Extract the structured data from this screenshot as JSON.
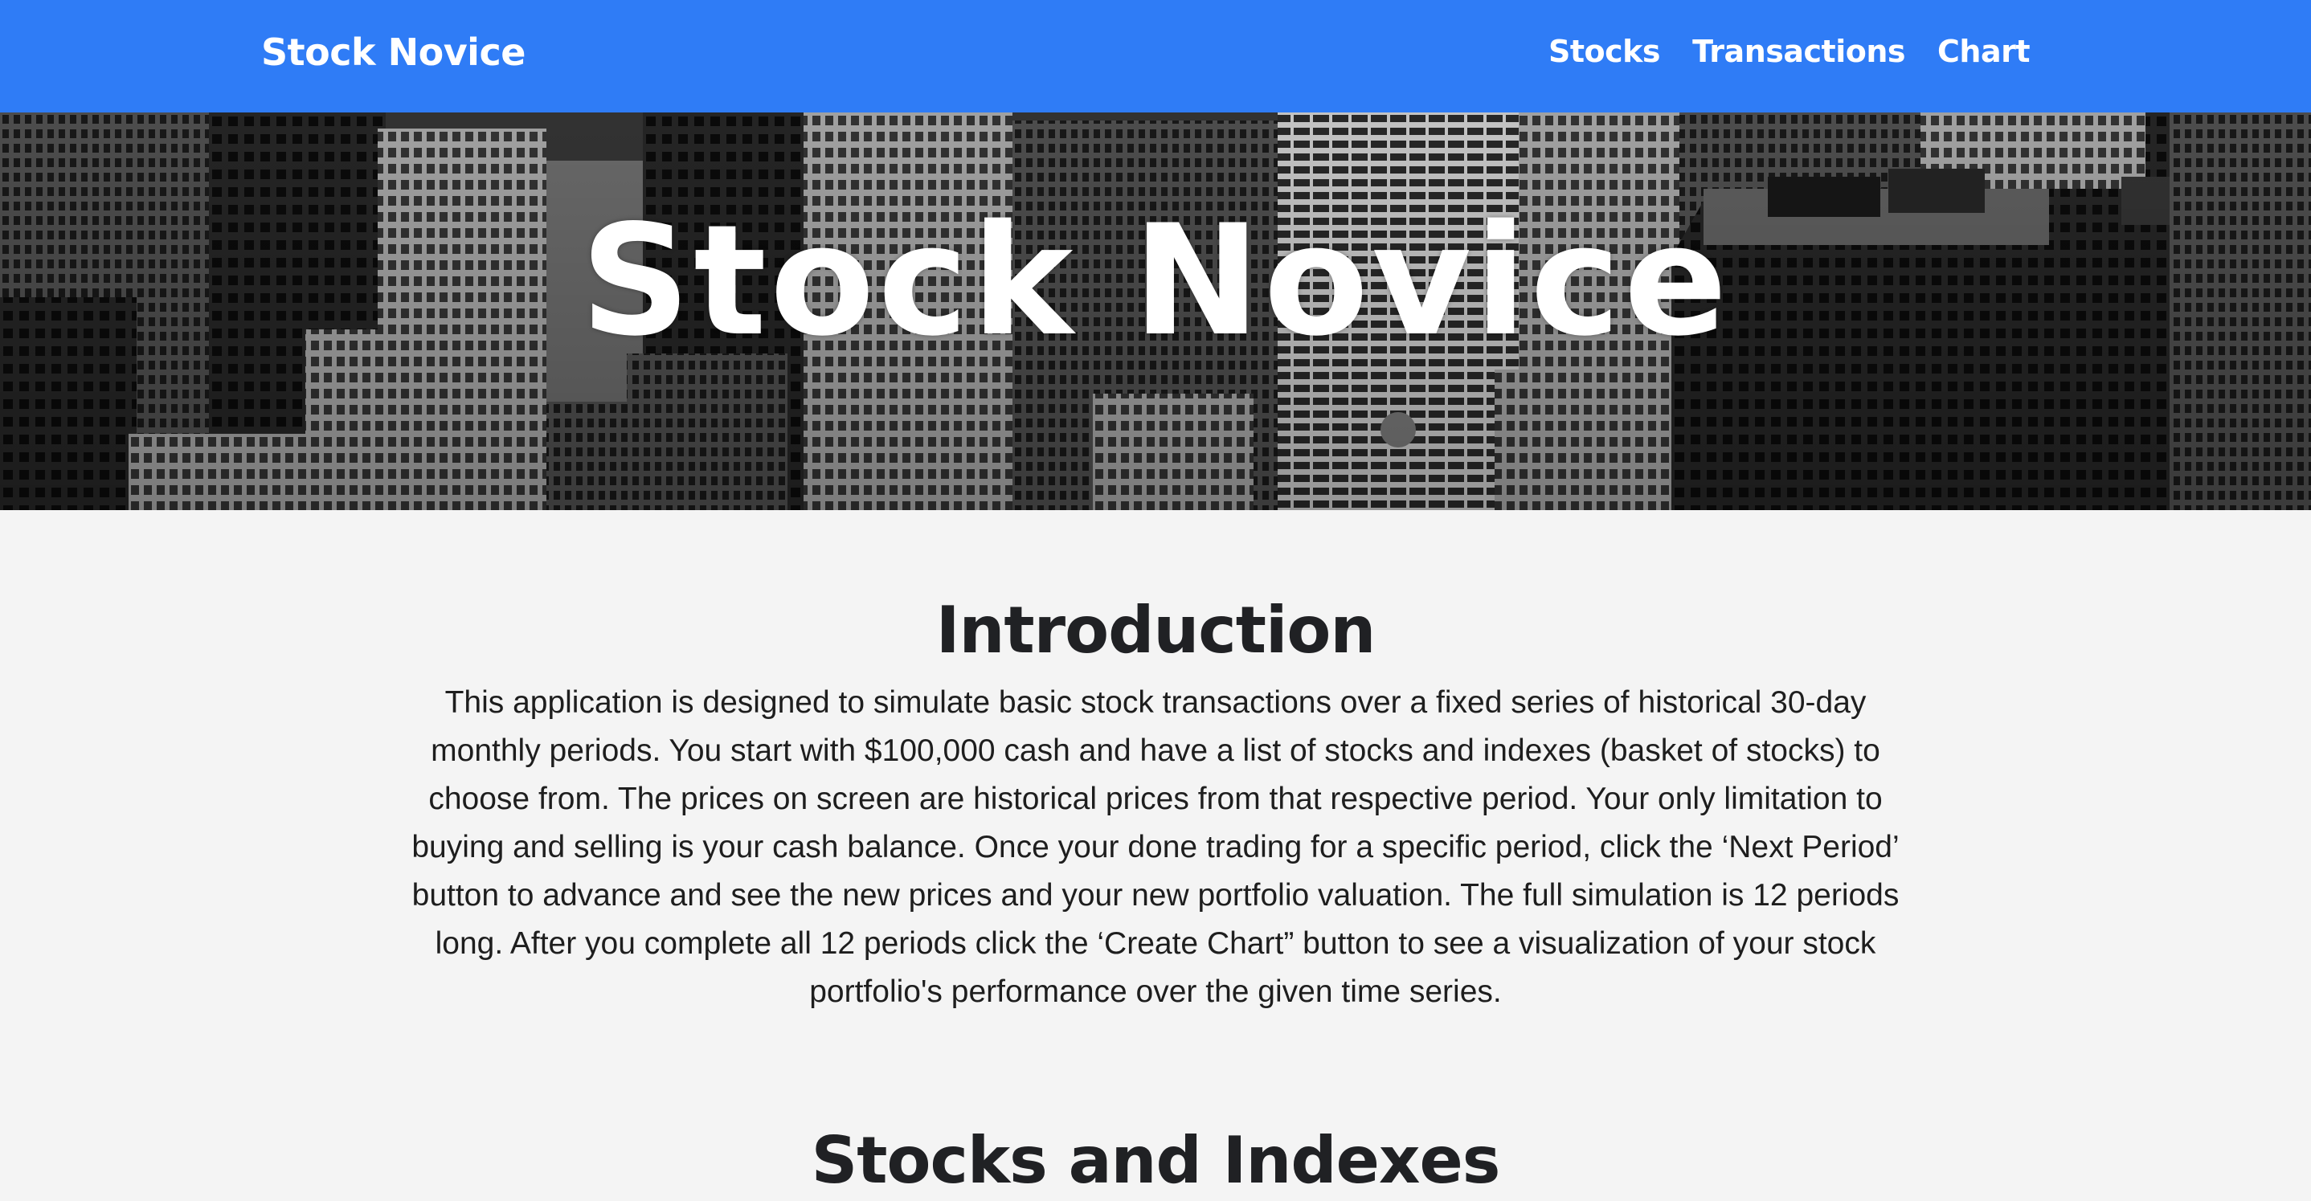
{
  "navbar": {
    "brand": "Stock Novice",
    "links": [
      "Stocks",
      "Transactions",
      "Chart"
    ],
    "background_color": "#2f7cf6"
  },
  "hero": {
    "title": "Stock Novice",
    "background": "black-and-white aerial photo of city skyscrapers"
  },
  "intro": {
    "title": "Introduction",
    "text": "This application is designed to simulate basic stock transactions over a fixed series of historical 30-day monthly periods. You start with $100,000 cash and have a list of stocks and indexes (basket of stocks) to choose from. The prices on screen are historical prices from that respective period. Your only limitation to buying and selling is your cash balance. Once your done trading for a specific period, click the ‘Next Period’ button to advance and see the new prices and your new portfolio valuation. The full simulation is 12 periods long. After you complete all 12 periods click the ‘Create Chart” button to see a visualization of your stock portfolio's performance over the given time series."
  },
  "stocks_section": {
    "title": "Stocks and Indexes"
  }
}
